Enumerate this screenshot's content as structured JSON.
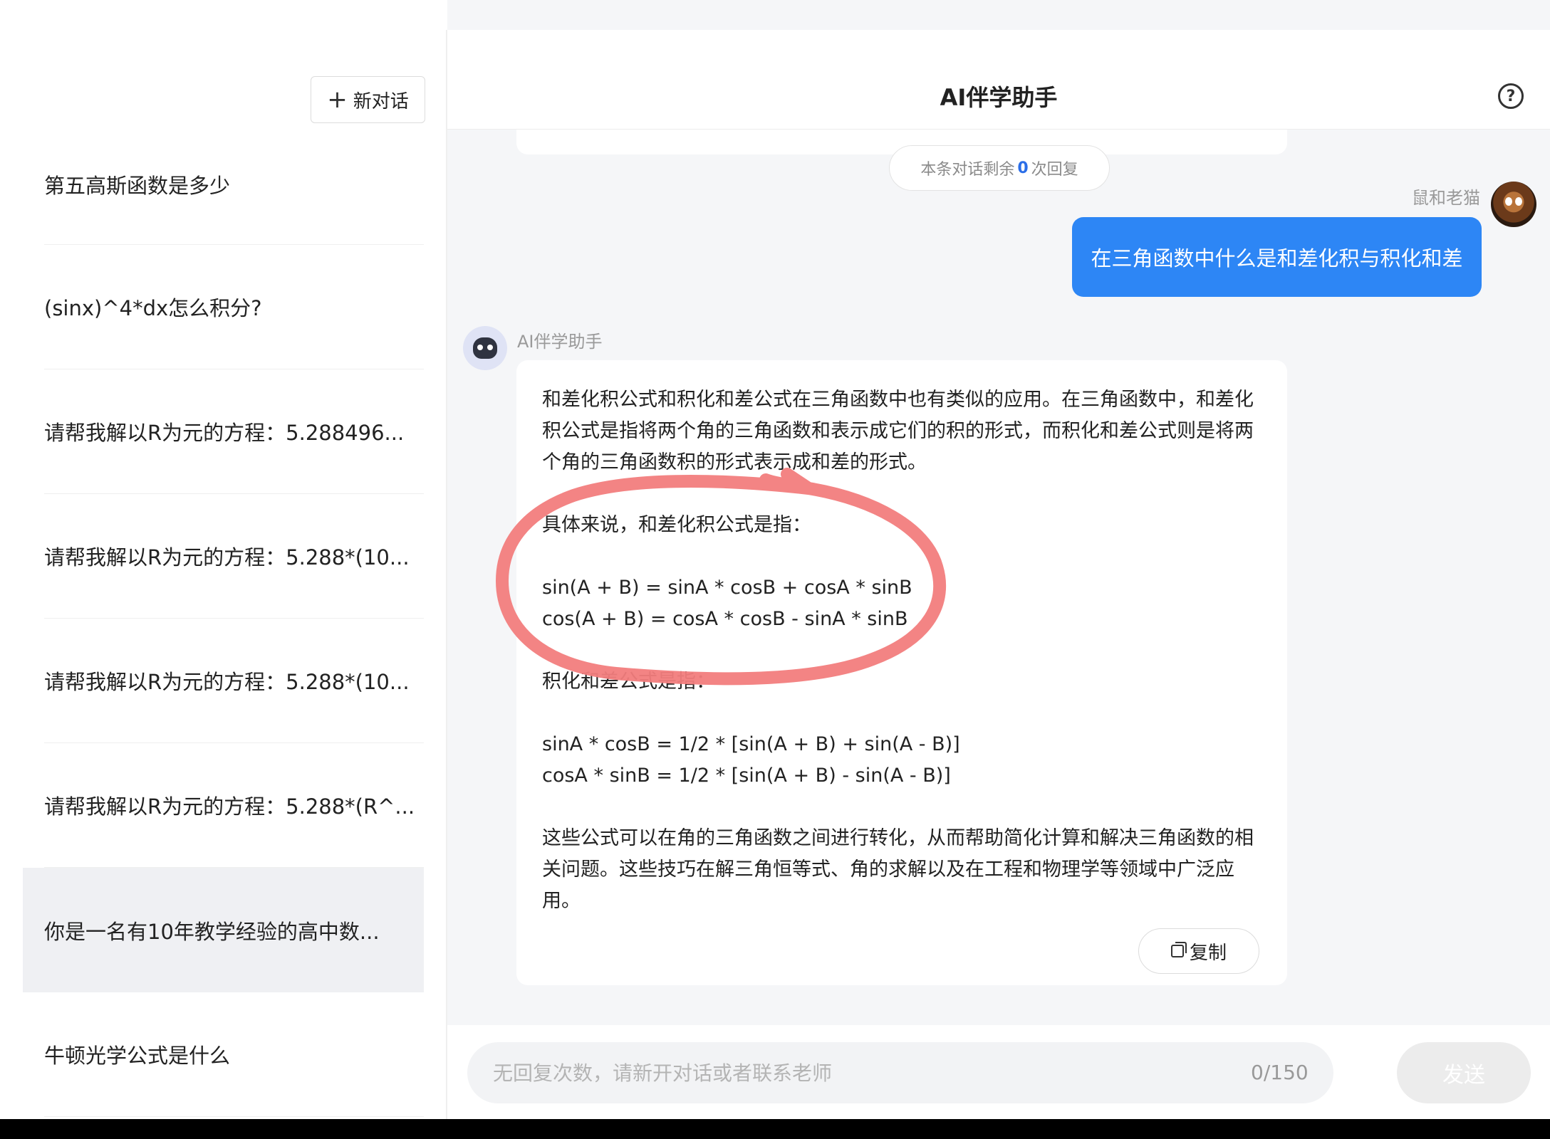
{
  "sidebar": {
    "new_chat_label": "新对话",
    "items": [
      {
        "label": "第五高斯函数是多少"
      },
      {
        "label": "(sinx)^4*dx怎么积分?"
      },
      {
        "label": "请帮我解以R为元的方程：5.288496..."
      },
      {
        "label": "请帮我解以R为元的方程：5.288*(10..."
      },
      {
        "label": "请帮我解以R为元的方程：5.288*(10..."
      },
      {
        "label": "请帮我解以R为元的方程：5.288*(R^..."
      },
      {
        "label": "你是一名有10年教学经验的高中数..."
      },
      {
        "label": "牛顿光学公式是什么"
      }
    ],
    "active_index": 6
  },
  "header": {
    "title": "AI伴学助手",
    "help_icon": "?"
  },
  "chat": {
    "remain_prefix": "本条对话剩余",
    "remain_count": "0",
    "remain_suffix": "次回复",
    "user": {
      "name": "鼠和老猫",
      "message": "在三角函数中什么是和差化积与积化和差"
    },
    "bot": {
      "name": "AI伴学助手",
      "paragraphs": [
        "和差化积公式和积化和差公式在三角函数中也有类似的应用。在三角函数中，和差化积公式是指将两个角的三角函数和表示成它们的积的形式，而积化和差公式则是将两个角的三角函数积的形式表示成和差的形式。",
        "具体来说，和差化积公式是指：",
        "sin(A + B) = sinA * cosB + cosA * sinB",
        "cos(A + B) = cosA * cosB - sinA * sinB",
        "积化和差公式是指：",
        "sinA * cosB = 1/2 * [sin(A + B) + sin(A - B)]",
        "cosA * sinB = 1/2 * [sin(A + B) - sin(A - B)]",
        "这些公式可以在角的三角函数之间进行转化，从而帮助简化计算和解决三角函数的相关问题。这些技巧在解三角恒等式、角的求解以及在工程和物理学等领域中广泛应用。"
      ],
      "copy_label": "复制"
    }
  },
  "input": {
    "placeholder": "无回复次数，请新开对话或者联系老师",
    "char_count": "0/150",
    "send_label": "发送"
  },
  "colors": {
    "accent": "#2d86f5",
    "annotation": "#f27d7d"
  }
}
